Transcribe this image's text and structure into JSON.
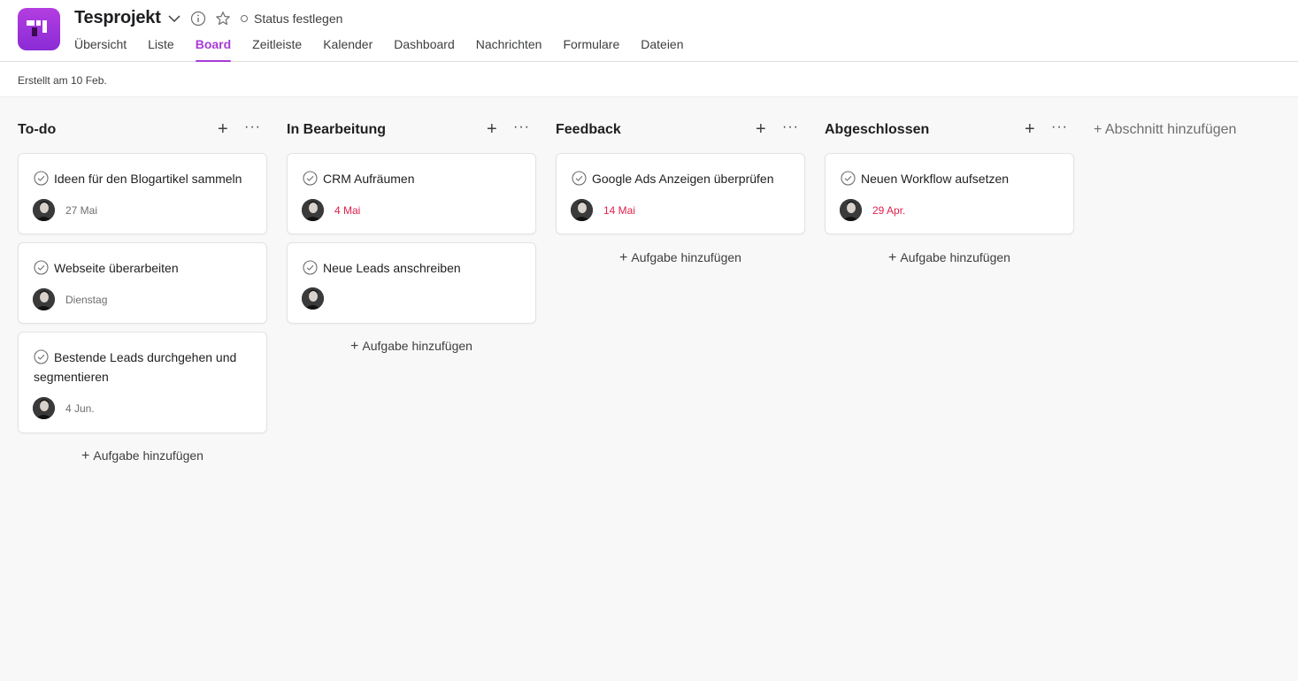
{
  "app": {
    "logo": "project-logo"
  },
  "header": {
    "title": "Tesprojekt",
    "status_label": "Status festlegen",
    "created": "Erstellt am 10 Feb."
  },
  "tabs": [
    {
      "label": "Übersicht",
      "active": false
    },
    {
      "label": "Liste",
      "active": false
    },
    {
      "label": "Board",
      "active": true
    },
    {
      "label": "Zeitleiste",
      "active": false
    },
    {
      "label": "Kalender",
      "active": false
    },
    {
      "label": "Dashboard",
      "active": false
    },
    {
      "label": "Nachrichten",
      "active": false
    },
    {
      "label": "Formulare",
      "active": false
    },
    {
      "label": "Dateien",
      "active": false
    }
  ],
  "colors": {
    "accent": "#a83bd6",
    "overdue": "#e0204c",
    "logo": "#9b32dc"
  },
  "board": {
    "add_section_label": "+ Abschnitt hinzufügen",
    "add_task_label": "Aufgabe hinzufügen",
    "columns": [
      {
        "title": "To-do",
        "tasks": [
          {
            "name": "Ideen für den Blogartikel sammeln",
            "due": "27 Mai",
            "overdue": false
          },
          {
            "name": "Webseite überarbeiten",
            "due": "Dienstag",
            "overdue": false
          },
          {
            "name": "Bestende Leads durchgehen und segmentieren",
            "due": "4 Jun.",
            "overdue": false
          }
        ]
      },
      {
        "title": "In Bearbeitung",
        "tasks": [
          {
            "name": "CRM Aufräumen",
            "due": "4 Mai",
            "overdue": true
          },
          {
            "name": "Neue Leads anschreiben",
            "due": "",
            "overdue": false
          }
        ]
      },
      {
        "title": "Feedback",
        "tasks": [
          {
            "name": "Google Ads Anzeigen überprüfen",
            "due": "14 Mai",
            "overdue": true
          }
        ]
      },
      {
        "title": "Abgeschlossen",
        "tasks": [
          {
            "name": "Neuen Workflow aufsetzen",
            "due": "29 Apr.",
            "overdue": true
          }
        ]
      }
    ]
  }
}
